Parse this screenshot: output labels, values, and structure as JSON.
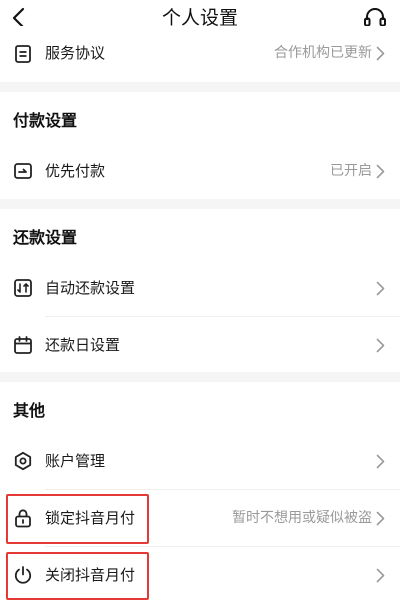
{
  "header": {
    "title": "个人设置"
  },
  "groups": {
    "top": {
      "items": [
        {
          "label": "服务协议",
          "value": "合作机构已更新",
          "icon": "document-icon"
        }
      ]
    },
    "payment": {
      "title": "付款设置",
      "items": [
        {
          "label": "优先付款",
          "value": "已开启",
          "icon": "priority-pay-icon"
        }
      ]
    },
    "repayment": {
      "title": "还款设置",
      "items": [
        {
          "label": "自动还款设置",
          "value": "",
          "icon": "auto-repay-icon"
        },
        {
          "label": "还款日设置",
          "value": "",
          "icon": "calendar-icon"
        }
      ]
    },
    "other": {
      "title": "其他",
      "items": [
        {
          "label": "账户管理",
          "value": "",
          "icon": "account-icon"
        },
        {
          "label": "锁定抖音月付",
          "value": "暂时不想用或疑似被盗",
          "icon": "lock-icon"
        },
        {
          "label": "关闭抖音月付",
          "value": "",
          "icon": "power-icon"
        }
      ]
    }
  },
  "colors": {
    "highlight": "#e53935",
    "secondary_text": "#9a9a9a",
    "background": "#f5f5f5"
  }
}
